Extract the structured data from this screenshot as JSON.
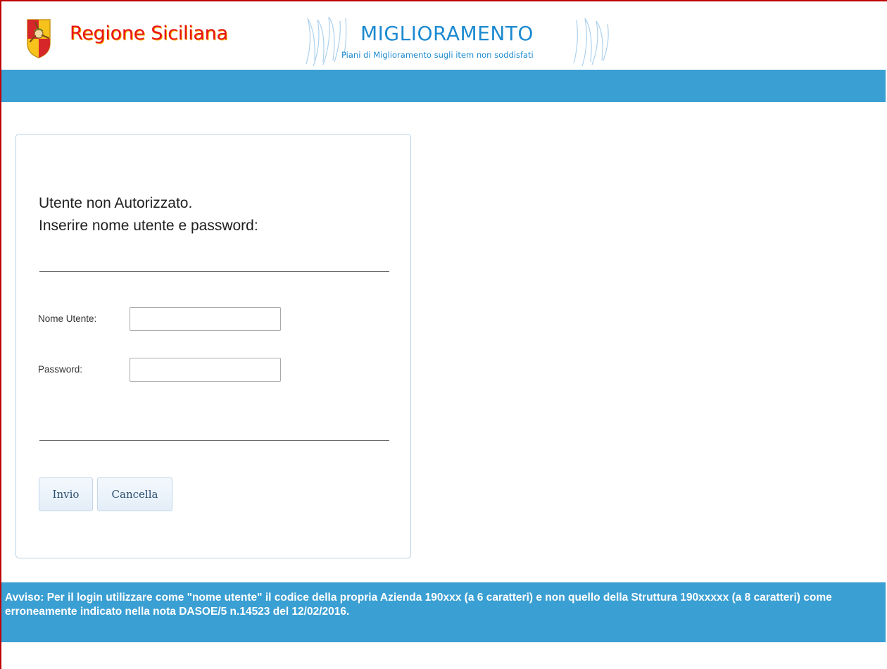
{
  "header": {
    "brand": "Regione Siciliana",
    "banner_title": "MIGLIORAMENTO",
    "banner_subtitle": "Piani di Miglioramento sugli item non soddisfati"
  },
  "login": {
    "heading_line1": "Utente non Autorizzato.",
    "heading_line2": "Inserire nome utente e password:",
    "username_label": "Nome Utente:",
    "username_value": "",
    "password_label": "Password:",
    "password_value": "",
    "submit_label": "Invio",
    "cancel_label": "Cancella"
  },
  "notice": {
    "text": "Avviso: Per il login utilizzare come \"nome utente\" il codice della propria Azienda 190xxx (a 6 caratteri) e non quello della Struttura 190xxxxx (a 8 caratteri) come erroneamente indicato nella nota DASOE/5 n.14523 del 12/02/2016."
  },
  "colors": {
    "accent_bar": "#3a9fd3",
    "brand_red": "#e8141b",
    "banner_blue": "#1c8ad0",
    "frame_border": "#c00000"
  },
  "icons": {
    "logo": "trinacria-crest-icon"
  }
}
